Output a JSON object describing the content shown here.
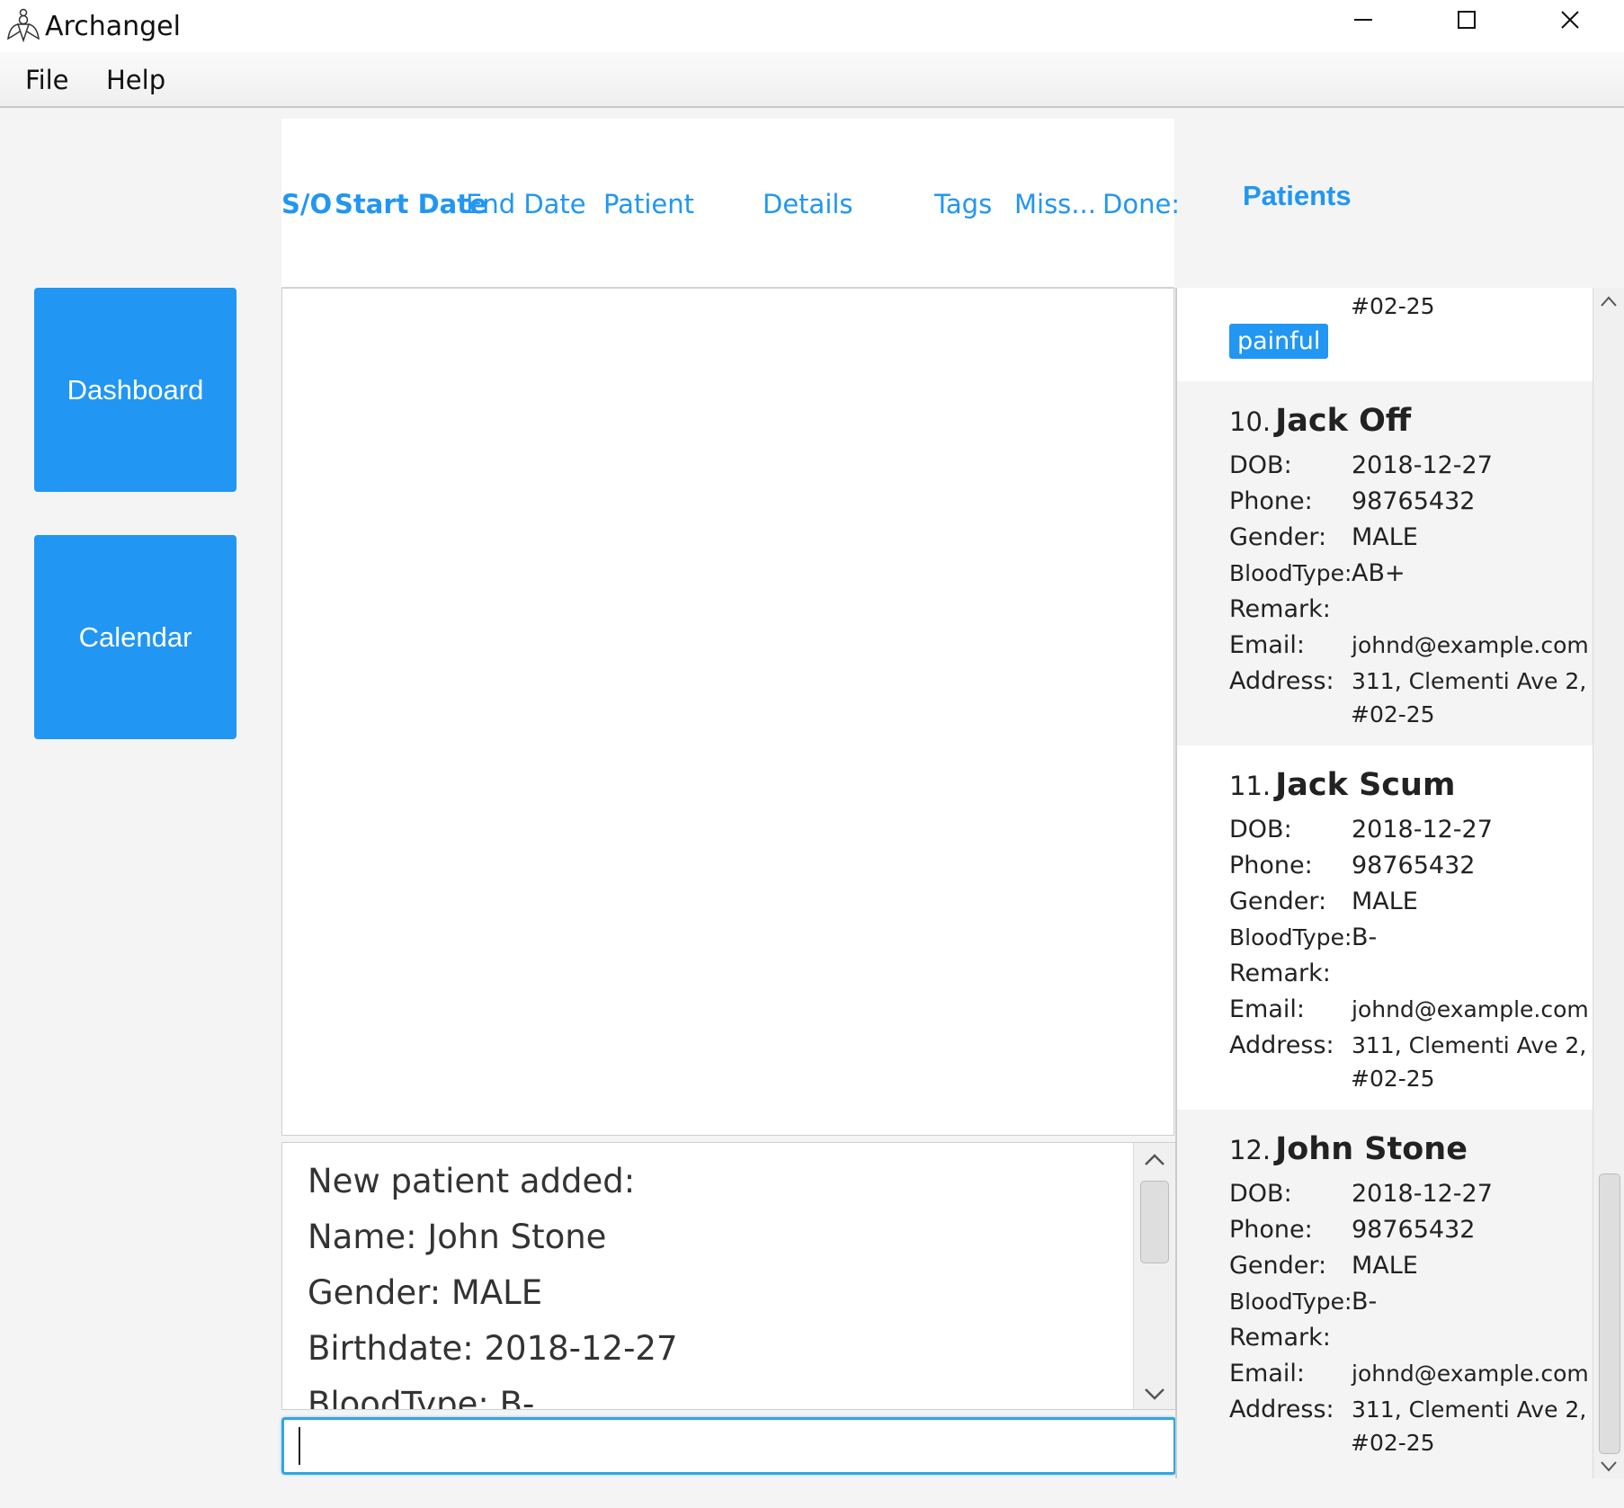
{
  "window": {
    "title": "Archangel"
  },
  "menu": {
    "file": "File",
    "help": "Help"
  },
  "nav": {
    "dashboard": "Dashboard",
    "calendar": "Calendar"
  },
  "table": {
    "columns": [
      "S/O",
      "Start Date",
      "End Date",
      "Patient",
      "Details",
      "Tags",
      "Miss...",
      "Done:"
    ]
  },
  "result": {
    "lines": [
      "New patient added:",
      "Name: John Stone",
      "Gender: MALE",
      "Birthdate: 2018-12-27",
      "BloodType: B-"
    ]
  },
  "command": {
    "value": ""
  },
  "patients": {
    "title": "Patients",
    "top_partial": {
      "address_line2": "#02-25",
      "tag": "painful"
    },
    "labels": {
      "dob": "DOB:",
      "phone": "Phone:",
      "gender": "Gender:",
      "bloodtype": "BloodType:",
      "remark": "Remark:",
      "email": "Email:",
      "address": "Address:"
    },
    "cards": [
      {
        "num": "10.",
        "name": "Jack Off",
        "dob": "2018-12-27",
        "phone": "98765432",
        "gender": "MALE",
        "bloodtype": "AB+",
        "remark": "",
        "email": "johnd@example.com",
        "address1": "311, Clementi Ave 2,",
        "address2": "#02-25"
      },
      {
        "num": "11.",
        "name": "Jack Scum",
        "dob": "2018-12-27",
        "phone": "98765432",
        "gender": "MALE",
        "bloodtype": "B-",
        "remark": "",
        "email": "johnd@example.com",
        "address1": "311, Clementi Ave 2,",
        "address2": "#02-25"
      },
      {
        "num": "12.",
        "name": "John Stone",
        "dob": "2018-12-27",
        "phone": "98765432",
        "gender": "MALE",
        "bloodtype": "B-",
        "remark": "",
        "email": "johnd@example.com",
        "address1": "311, Clementi Ave 2,",
        "address2": "#02-25"
      }
    ]
  }
}
